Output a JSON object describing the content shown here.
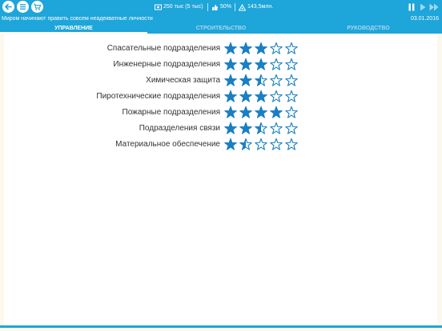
{
  "toolbar": {
    "back_icon": "back-arrow-icon",
    "menu_icon": "list-menu-icon",
    "shop_icon": "cart-icon",
    "money": "250 тыс (5 тыс)",
    "approval": "50%",
    "population": "143,5млн.",
    "pause_icon": "pause-icon",
    "play_icon": "play-icon",
    "fast_forward_icon": "fast-forward-icon"
  },
  "ticker": {
    "news": "Миром начинают править совсем неадекватные личности",
    "date": "03.01.2016"
  },
  "tabs": [
    {
      "label": "УПРАВЛЕНИЕ",
      "active": true
    },
    {
      "label": "СТРОИТЕЛЬСТВО",
      "active": false
    },
    {
      "label": "РУКОВОДСТВО",
      "active": false
    }
  ],
  "departments": [
    {
      "name": "Спасательные подразделения",
      "rating": 3
    },
    {
      "name": "Инженерные подразделения",
      "rating": 3
    },
    {
      "name": "Химическая защита",
      "rating": 2.5
    },
    {
      "name": "Пиротехнические подразделения",
      "rating": 3
    },
    {
      "name": "Пожарные подразделения",
      "rating": 4
    },
    {
      "name": "Подразделения связи",
      "rating": 2.5
    },
    {
      "name": "Материальное обеспечение",
      "rating": 1.5
    }
  ],
  "colors": {
    "accent": "#1ea5da",
    "star": "#1a7fc4",
    "background": "#fdf8ec"
  }
}
